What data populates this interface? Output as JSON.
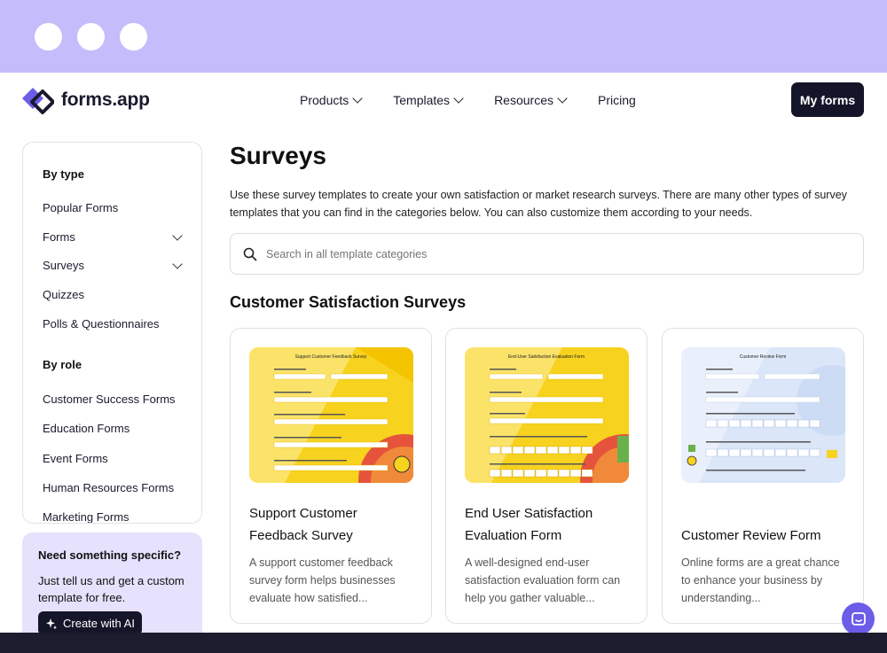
{
  "brand": {
    "name": "forms.app",
    "accent": "#6b5de8",
    "dark": "#15152a"
  },
  "nav": {
    "items": [
      {
        "label": "Products",
        "dropdown": true
      },
      {
        "label": "Templates",
        "dropdown": true
      },
      {
        "label": "Resources",
        "dropdown": true
      },
      {
        "label": "Pricing",
        "dropdown": false
      }
    ],
    "cta": "My forms"
  },
  "sidebar": {
    "by_type_heading": "By type",
    "type_items": [
      {
        "label": "Popular Forms",
        "expandable": false
      },
      {
        "label": "Forms",
        "expandable": true
      },
      {
        "label": "Surveys",
        "expandable": true
      },
      {
        "label": "Quizzes",
        "expandable": false
      },
      {
        "label": "Polls & Questionnaires",
        "expandable": false
      }
    ],
    "by_role_heading": "By role",
    "role_items": [
      "Customer Success Forms",
      "Education Forms",
      "Event Forms",
      "Human Resources Forms",
      "Marketing Forms"
    ]
  },
  "promo": {
    "title": "Need something specific?",
    "text": "Just tell us and get a custom template for free.",
    "button": "Create with AI"
  },
  "main": {
    "title": "Surveys",
    "description": "Use these survey templates to create your own satisfaction or market research surveys. There are many other types of survey templates that you can find in the categories below. You can also customize them according to your needs.",
    "search_placeholder": "Search in all template categories",
    "section_title": "Customer Satisfaction Surveys",
    "cards": [
      {
        "thumb_title": "Support Customer Feedback Survey",
        "title": "Support Customer Feedback Survey",
        "description": "A support customer feedback survey form helps businesses evaluate how satisfied...",
        "theme": "yellow"
      },
      {
        "thumb_title": "End-User Satisfaction Evaluation Form",
        "title": "End User Satisfaction Evaluation Form",
        "description": "A well-designed end-user satisfaction evaluation form can help you gather valuable...",
        "theme": "yellow"
      },
      {
        "thumb_title": "Customer Review Form",
        "title": "Customer Review Form",
        "description": "Online forms are a great chance to enhance your business by understanding...",
        "theme": "blue"
      }
    ]
  }
}
